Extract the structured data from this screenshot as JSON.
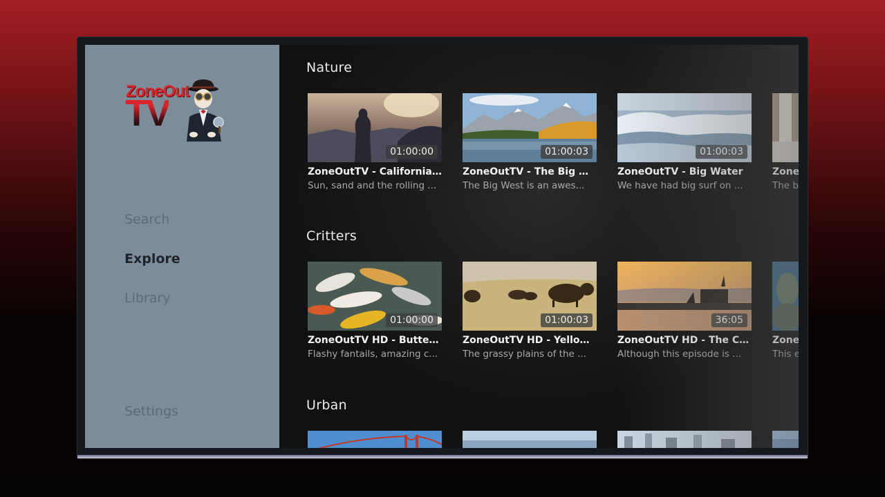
{
  "sidebar": {
    "logo": {
      "line1": "ZoneOut",
      "line2": "TV"
    },
    "nav": [
      {
        "label": "Search",
        "active": false
      },
      {
        "label": "Explore",
        "active": true
      },
      {
        "label": "Library",
        "active": false
      }
    ],
    "settings_label": "Settings"
  },
  "rows": [
    {
      "title": "Nature",
      "items": [
        {
          "title": "ZoneOutTV - California ...",
          "description": "Sun, sand and the rolling ...",
          "duration": "01:00:00",
          "thumb": "beach-silhouette"
        },
        {
          "title": "ZoneOutTV - The Big W...",
          "description": "The Big West is an awes...",
          "duration": "01:00:03",
          "thumb": "mountain-lake"
        },
        {
          "title": "ZoneOutTV - Big Water",
          "description": "We have had big surf on ...",
          "duration": "01:00:03",
          "thumb": "ocean-waves"
        },
        {
          "title": "ZoneOu",
          "description": "The b",
          "duration": "",
          "thumb": "waterfall"
        }
      ]
    },
    {
      "title": "Critters",
      "items": [
        {
          "title": "ZoneOutTV HD - Butterfl...",
          "description": "Flashy fantails, amazing c...",
          "duration": "01:00:00",
          "thumb": "koi-fish"
        },
        {
          "title": "ZoneOutTV HD - Yellow...",
          "description": "The grassy plains of the ...",
          "duration": "01:00:03",
          "thumb": "bison-plains"
        },
        {
          "title": "ZoneOutTV HD - The Ch...",
          "description": "Although this episode is ...",
          "duration": "36:05",
          "thumb": "harbor-sunset"
        },
        {
          "title": "ZoneO",
          "description": "This e",
          "duration": "",
          "thumb": "statue"
        }
      ]
    },
    {
      "title": "Urban",
      "items": [
        {
          "title": "",
          "description": "",
          "duration": "",
          "thumb": "golden-gate"
        },
        {
          "title": "",
          "description": "",
          "duration": "",
          "thumb": "city-sky"
        },
        {
          "title": "",
          "description": "",
          "duration": "",
          "thumb": "city-skyline"
        },
        {
          "title": "",
          "description": "",
          "duration": "",
          "thumb": "city-sky"
        }
      ]
    }
  ],
  "colors": {
    "background_top": "#a31e23",
    "sidebar": "#7d8c9a",
    "nav_inactive": "#5e6a76",
    "nav_active": "#1e2329",
    "logo_red": "#d8262c"
  }
}
